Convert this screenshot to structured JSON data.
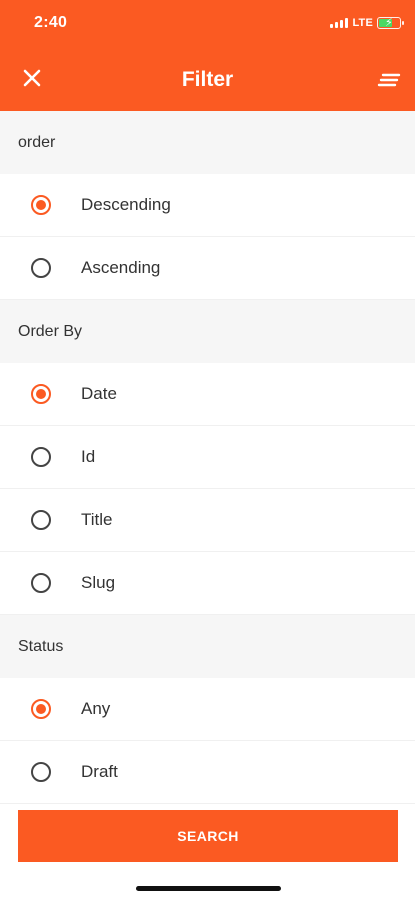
{
  "status_bar": {
    "time": "2:40",
    "network": "LTE"
  },
  "header": {
    "title": "Filter"
  },
  "sections": [
    {
      "title": "order",
      "options": [
        {
          "label": "Descending",
          "selected": true
        },
        {
          "label": "Ascending",
          "selected": false
        }
      ]
    },
    {
      "title": "Order By",
      "options": [
        {
          "label": "Date",
          "selected": true
        },
        {
          "label": "Id",
          "selected": false
        },
        {
          "label": "Title",
          "selected": false
        },
        {
          "label": "Slug",
          "selected": false
        }
      ]
    },
    {
      "title": "Status",
      "options": [
        {
          "label": "Any",
          "selected": true
        },
        {
          "label": "Draft",
          "selected": false
        }
      ]
    }
  ],
  "search_button": {
    "label": "SEARCH"
  },
  "colors": {
    "accent": "#fb5a22",
    "section_bg": "#f6f6f6"
  },
  "icons": {
    "close": "close-icon",
    "menu": "menu-icon"
  }
}
